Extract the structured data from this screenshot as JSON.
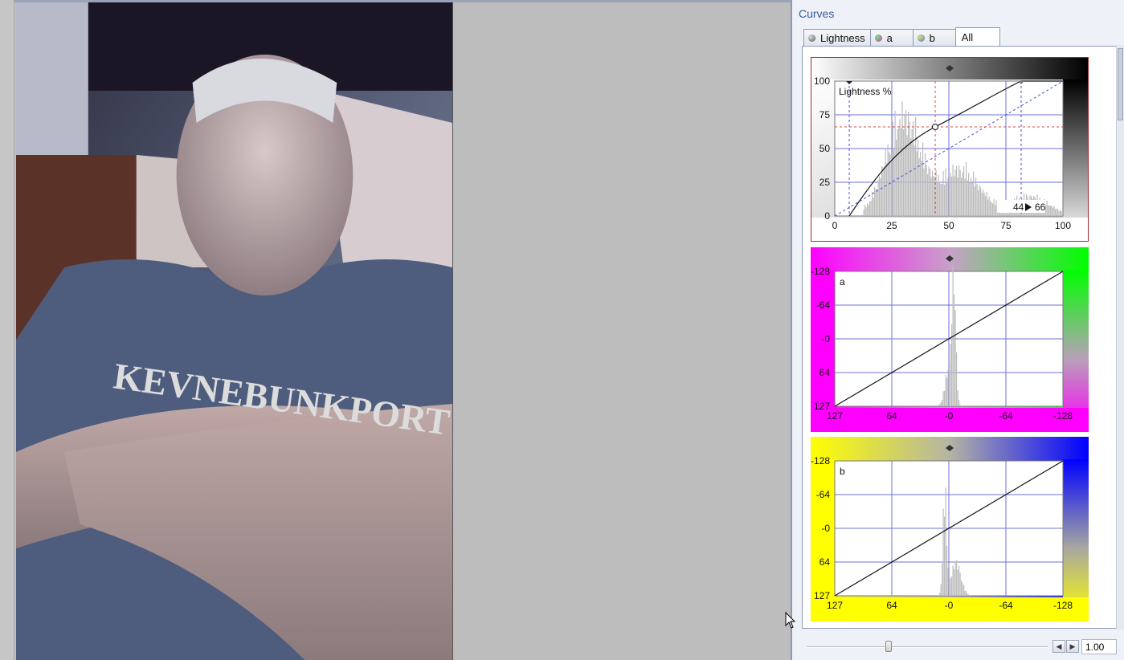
{
  "panel": {
    "title": "Curves"
  },
  "tabs": [
    {
      "label": "Lightness",
      "icon": "lightness-dot-icon",
      "icon_color": "#666666"
    },
    {
      "label": "a",
      "icon": "a-channel-dot-icon",
      "icon_color": "#c040c0"
    },
    {
      "label": "b",
      "icon": "b-channel-dot-icon",
      "icon_color": "#4a7ad0"
    },
    {
      "label": "All",
      "active": true
    }
  ],
  "lightness": {
    "label": "Lightness %",
    "y_ticks": [
      "100",
      "75",
      "50",
      "25",
      "0"
    ],
    "x_ticks": [
      "0",
      "25",
      "50",
      "75",
      "100"
    ],
    "readout_in": "44",
    "readout_out": "66"
  },
  "a_channel": {
    "label": "a",
    "y_ticks": [
      "-128",
      "-64",
      "-0",
      "64",
      "127"
    ],
    "x_ticks": [
      "127",
      "64",
      "-0",
      "-64",
      "-128"
    ],
    "gradient_colors": [
      "#ff00ff",
      "#00ff00"
    ]
  },
  "b_channel": {
    "label": "b",
    "y_ticks": [
      "-128",
      "-64",
      "-0",
      "64",
      "127"
    ],
    "x_ticks": [
      "127",
      "64",
      "-0",
      "-64",
      "-128"
    ],
    "gradient_colors": [
      "#ffff00",
      "#0000ff"
    ]
  },
  "zoom": {
    "value": "1.00",
    "slider_fraction": 0.34
  },
  "photo": {
    "shirt_text": "KEVNEBUNKPORT"
  }
}
